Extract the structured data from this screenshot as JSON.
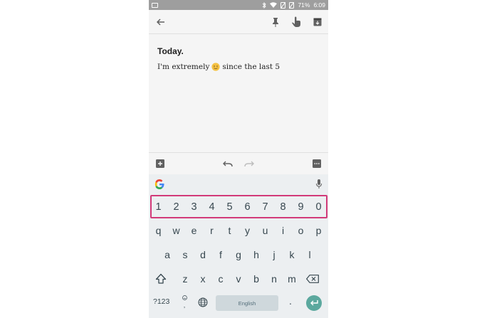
{
  "status_bar": {
    "battery": "71%",
    "time": "6:09",
    "icons": [
      "gallery-icon",
      "bluetooth-icon",
      "wifi-icon",
      "no-sim-icon",
      "no-signal-icon"
    ]
  },
  "toolbar": {
    "icons": [
      "back-arrow-icon",
      "pin-icon",
      "reminder-hand-icon",
      "archive-icon"
    ]
  },
  "note": {
    "title": "Today.",
    "body_before": "I'm extremely",
    "body_after": "since the last 5",
    "emoji": "slightly-smiling-emoji"
  },
  "note_actions": {
    "icons": [
      "add-box-icon",
      "undo-icon",
      "redo-icon",
      "more-icon"
    ]
  },
  "keyboard": {
    "number_row": [
      "1",
      "2",
      "3",
      "4",
      "5",
      "6",
      "7",
      "8",
      "9",
      "0"
    ],
    "row_q": [
      "q",
      "w",
      "e",
      "r",
      "t",
      "y",
      "u",
      "i",
      "o",
      "p"
    ],
    "row_a": [
      "a",
      "s",
      "d",
      "f",
      "g",
      "h",
      "j",
      "k",
      "l"
    ],
    "row_z": [
      "z",
      "x",
      "c",
      "v",
      "b",
      "n",
      "m"
    ],
    "symbols_key": "?123",
    "comma_key": ",",
    "space_label": "English",
    "period_key": ".",
    "highlight_color": "#d23a79",
    "enter_color": "#5ba89e"
  }
}
